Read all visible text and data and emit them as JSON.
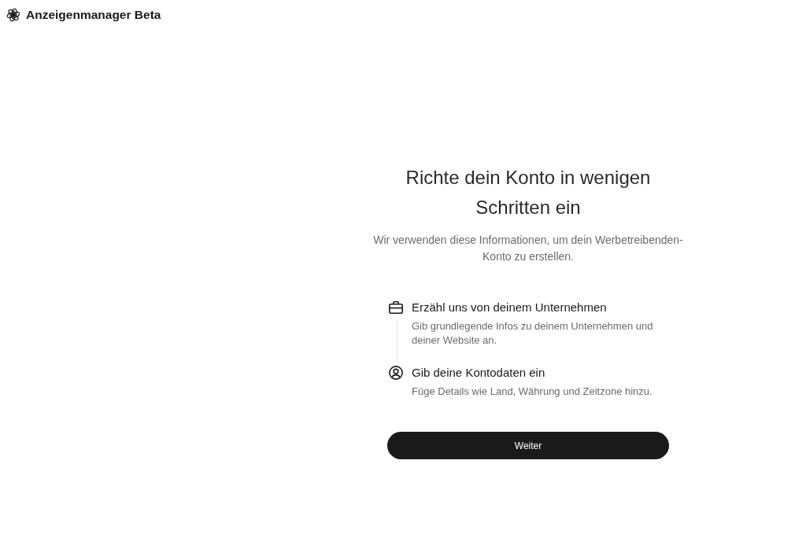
{
  "header": {
    "title": "Anzeigenmanager Beta"
  },
  "setup": {
    "title": "Richte dein Konto in wenigen Schritten ein",
    "subtitle": "Wir verwenden diese Informationen, um dein Werbetreibenden-Konto zu erstellen.",
    "steps": [
      {
        "kind": "business",
        "title": "Erzähl uns von deinem Unternehmen",
        "description": "Gib grundlegende Infos zu deinem Unternehmen und deiner Website an."
      },
      {
        "kind": "account",
        "title": "Gib deine Kontodaten ein",
        "description": "Füge Details wie Land, Währung und Zeitzone hinzu."
      }
    ],
    "button": "Weiter"
  }
}
